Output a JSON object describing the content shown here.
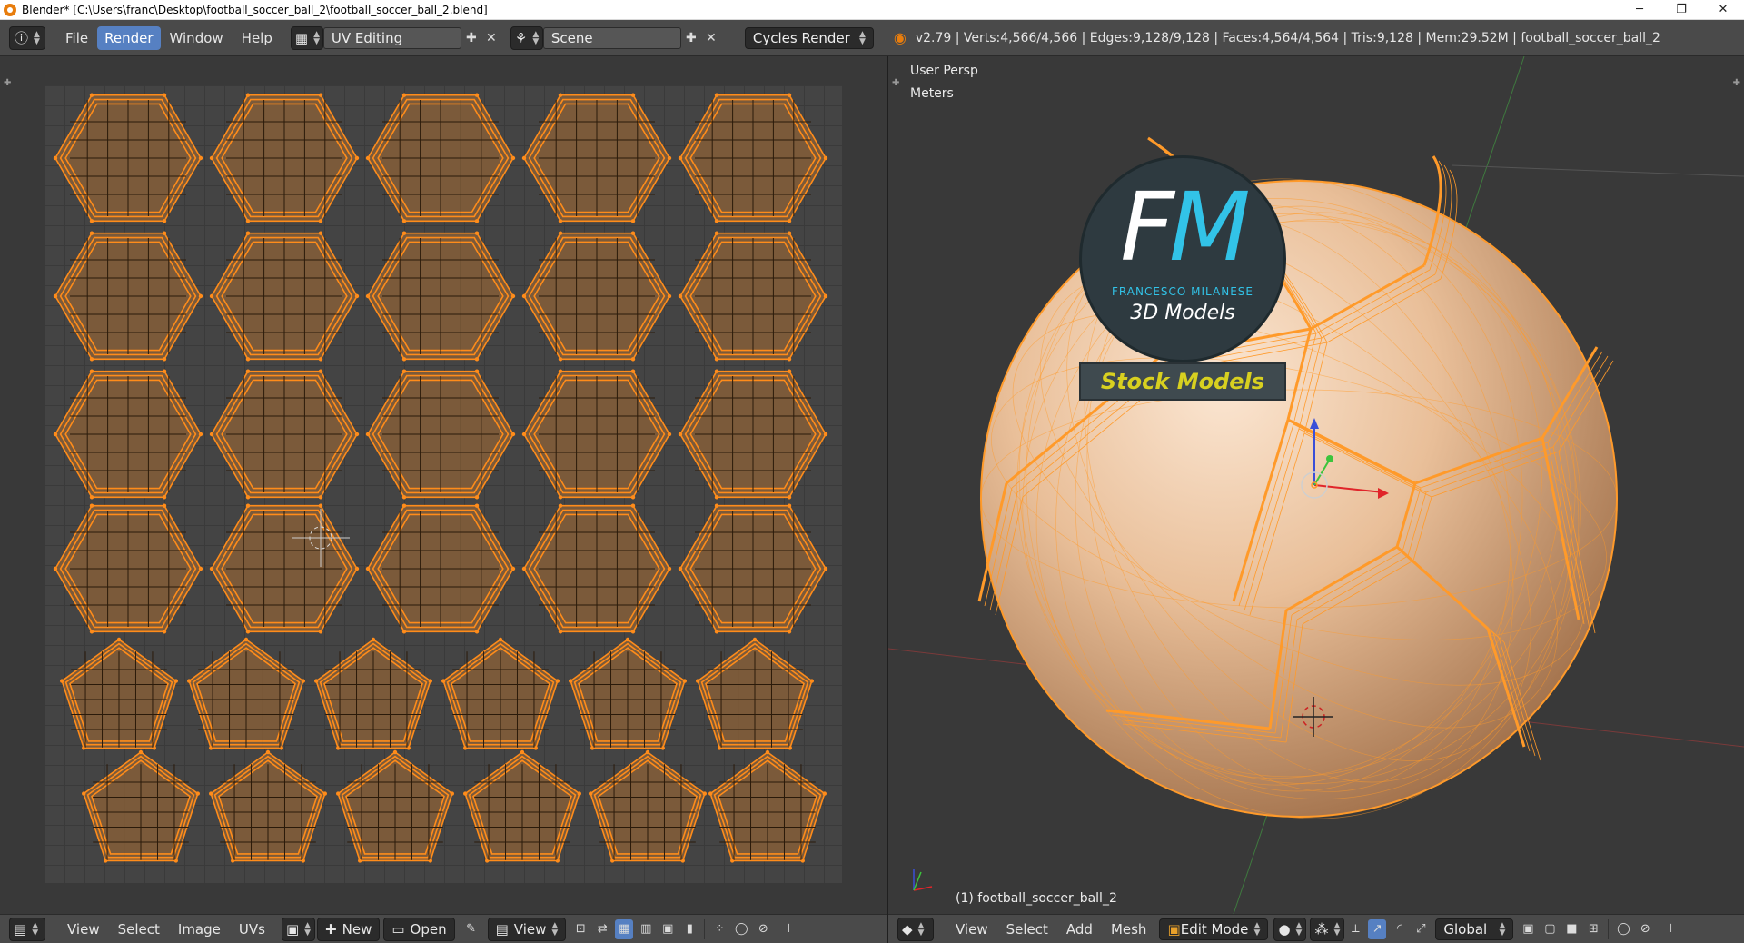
{
  "window": {
    "title": "Blender* [C:\\Users\\franc\\Desktop\\football_soccer_ball_2\\football_soccer_ball_2.blend]",
    "minimize_glyph": "─",
    "maximize_glyph": "❐",
    "close_glyph": "✕"
  },
  "info_header": {
    "menus": [
      "File",
      "Render",
      "Window",
      "Help"
    ],
    "active_menu": "Render",
    "screen_layout": "UV Editing",
    "scene": "Scene",
    "render_engine": "Cycles Render",
    "stats": "v2.79 | Verts:4,566/4,566 | Edges:9,128/9,128 | Faces:4,564/4,564 | Tris:9,128 | Mem:29.52M | football_soccer_ball_2"
  },
  "uv_editor": {
    "footer": {
      "menus": [
        "View",
        "Select",
        "Image",
        "UVs"
      ],
      "new_label": "New",
      "open_label": "Open",
      "view_label": "View"
    }
  },
  "viewport": {
    "view_name": "User Persp",
    "units": "Meters",
    "object_label": "(1) football_soccer_ball_2",
    "footer": {
      "menus": [
        "View",
        "Select",
        "Add",
        "Mesh"
      ],
      "mode": "Edit Mode",
      "orientation": "Global"
    }
  },
  "watermark": {
    "logo_letters": "FM",
    "author": "FRANCESCO MILANESE",
    "tagline": "3D Models",
    "banner": "Stock Models"
  },
  "colors": {
    "accent": "#5680c2",
    "uv_edge": "#ff8c1a",
    "uv_fill": "#7b5a3a",
    "ball": "#e3b48c"
  }
}
